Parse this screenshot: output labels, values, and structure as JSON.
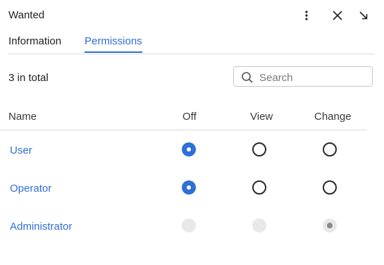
{
  "window": {
    "title": "Wanted"
  },
  "header_icons": [
    "more-vertical-icon",
    "close-icon",
    "minimize-arrow-icon"
  ],
  "tabs": [
    {
      "label": "Information",
      "active": false
    },
    {
      "label": "Permissions",
      "active": true
    }
  ],
  "summary": {
    "count_text": "3 in total"
  },
  "search": {
    "placeholder": "Search",
    "value": ""
  },
  "table": {
    "columns": [
      "Name",
      "Off",
      "View",
      "Change"
    ],
    "rows": [
      {
        "name": "User",
        "selected": "Off",
        "disabled": false
      },
      {
        "name": "Operator",
        "selected": "Off",
        "disabled": false
      },
      {
        "name": "Administrator",
        "selected": "Change",
        "disabled": true
      }
    ]
  },
  "colors": {
    "accent": "#2f6fd6",
    "text": "#1f1f1f",
    "divider": "#dcdcdc",
    "disabled": "#e8e8e8"
  }
}
